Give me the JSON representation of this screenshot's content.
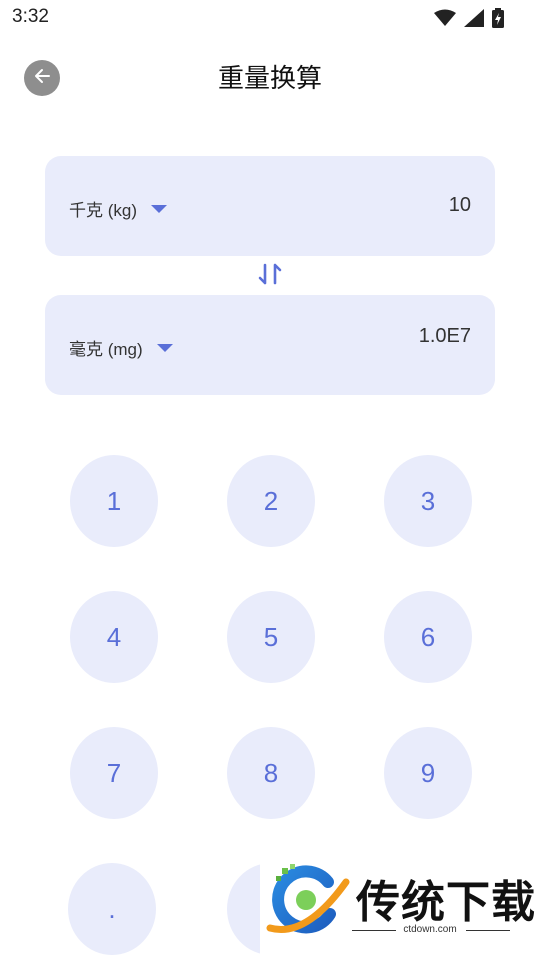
{
  "status_bar": {
    "time": "3:32"
  },
  "header": {
    "title": "重量换算"
  },
  "converter": {
    "from": {
      "unit": "千克 (kg)",
      "value": "10"
    },
    "to": {
      "unit": "毫克 (mg)",
      "value": "1.0E7"
    }
  },
  "keypad": {
    "keys": [
      "1",
      "2",
      "3",
      "4",
      "5",
      "6",
      "7",
      "8",
      "9",
      "."
    ]
  },
  "watermark": {
    "brand": "传统下载",
    "site": "ctdown.com"
  },
  "colors": {
    "accent": "#5a6fd8",
    "card_bg": "#e9ecfb",
    "back_bg": "#8e8e8e"
  },
  "icons": {
    "back": "arrow-left-icon",
    "swap": "swap-vertical-icon",
    "dropdown": "caret-down-icon",
    "wifi": "wifi-icon",
    "signal": "signal-icon",
    "battery": "battery-charging-icon"
  }
}
